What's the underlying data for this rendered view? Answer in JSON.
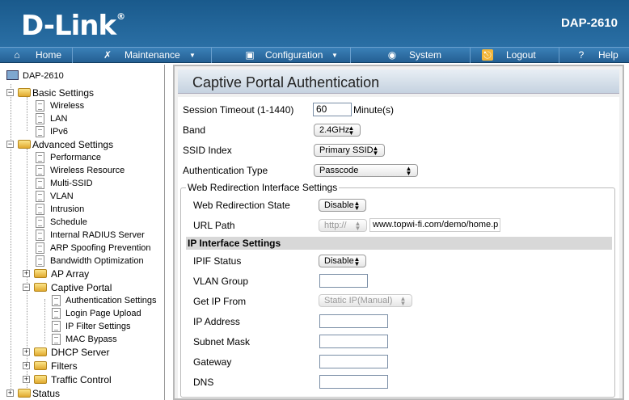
{
  "header": {
    "brand": "D-Link",
    "reg": "®",
    "model": "DAP-2610"
  },
  "menu": [
    {
      "icon": "home-icon",
      "label": "Home"
    },
    {
      "icon": "tools-icon",
      "label": "Maintenance",
      "arrow": "▼"
    },
    {
      "icon": "disk-icon",
      "label": "Configuration",
      "arrow": "▼"
    },
    {
      "icon": "system-icon",
      "label": "System"
    },
    {
      "icon": "logout-icon",
      "label": "Logout"
    },
    {
      "icon": "help-icon",
      "label": "Help"
    }
  ],
  "tree": {
    "root": "DAP-2610",
    "basic": "Basic Settings",
    "basic_items": [
      "Wireless",
      "LAN",
      "IPv6"
    ],
    "advanced": "Advanced Settings",
    "advanced_items": [
      "Performance",
      "Wireless Resource",
      "Multi-SSID",
      "VLAN",
      "Intrusion",
      "Schedule",
      "Internal RADIUS Server",
      "ARP Spoofing Prevention",
      "Bandwidth Optimization"
    ],
    "ap_array": "AP Array",
    "captive": "Captive Portal",
    "captive_items": [
      "Authentication Settings",
      "Login Page Upload",
      "IP Filter Settings",
      "MAC Bypass"
    ],
    "dhcp": "DHCP Server",
    "filters": "Filters",
    "traffic": "Traffic Control",
    "status": "Status",
    "plus": "+",
    "minus": "−"
  },
  "page": {
    "title": "Captive Portal Authentication",
    "session_timeout_label": "Session Timeout (1-1440)",
    "session_timeout_value": "60",
    "session_timeout_unit": "Minute(s)",
    "band_label": "Band",
    "band_value": "2.4GHz",
    "ssid_label": "SSID Index",
    "ssid_value": "Primary SSID",
    "auth_label": "Authentication Type",
    "auth_value": "Passcode",
    "legend": "Web Redirection Interface Settings",
    "redir_state_label": "Web Redirection State",
    "redir_state_value": "Disable",
    "url_label": "URL Path",
    "url_scheme": "http://",
    "url_value": "www.topwi-fi.com/demo/home.p",
    "ipif_title": "IP Interface Settings",
    "ipif_status_label": "IPIF Status",
    "ipif_status_value": "Disable",
    "vlan_label": "VLAN Group",
    "vlan_value": "",
    "getip_label": "Get IP From",
    "getip_value": "Static IP(Manual)",
    "ip_label": "IP Address",
    "mask_label": "Subnet Mask",
    "gw_label": "Gateway",
    "dns_label": "DNS",
    "arrows": "▲▼"
  }
}
